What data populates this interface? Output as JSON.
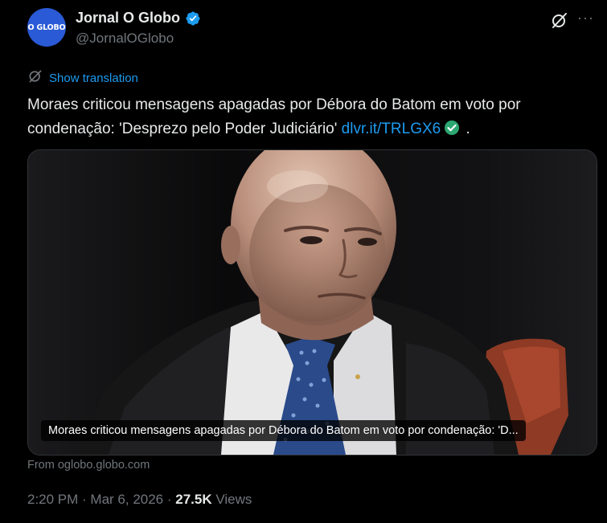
{
  "author": {
    "avatar_text": "O GLOBO",
    "display_name": "Jornal O Globo",
    "handle": "@JornalOGlobo"
  },
  "show_translation": "Show translation",
  "tweet": {
    "text": "Moraes criticou mensagens apagadas por Débora do Batom em voto por condenação: 'Desprezo pelo Poder Judiciário'",
    "link": "dlvr.it/TRLGX6",
    "trailing": "."
  },
  "card": {
    "caption": "Moraes criticou mensagens apagadas por Débora do Batom em voto por condenação: 'D..."
  },
  "source": "From oglobo.globo.com",
  "meta": {
    "time": "2:20 PM",
    "separator": " · ",
    "date": "Mar 6, 2026",
    "views_count": "27.5K",
    "views_label": "Views"
  },
  "colors": {
    "accent": "#1d9bf0",
    "verified": "#1d9bf0",
    "check_badge": "#2da771",
    "avatar_bg": "#2a5ad6"
  },
  "icons": [
    "verified-badge-icon",
    "grok-icon",
    "more-icon",
    "translate-icon",
    "checkmark-icon"
  ]
}
